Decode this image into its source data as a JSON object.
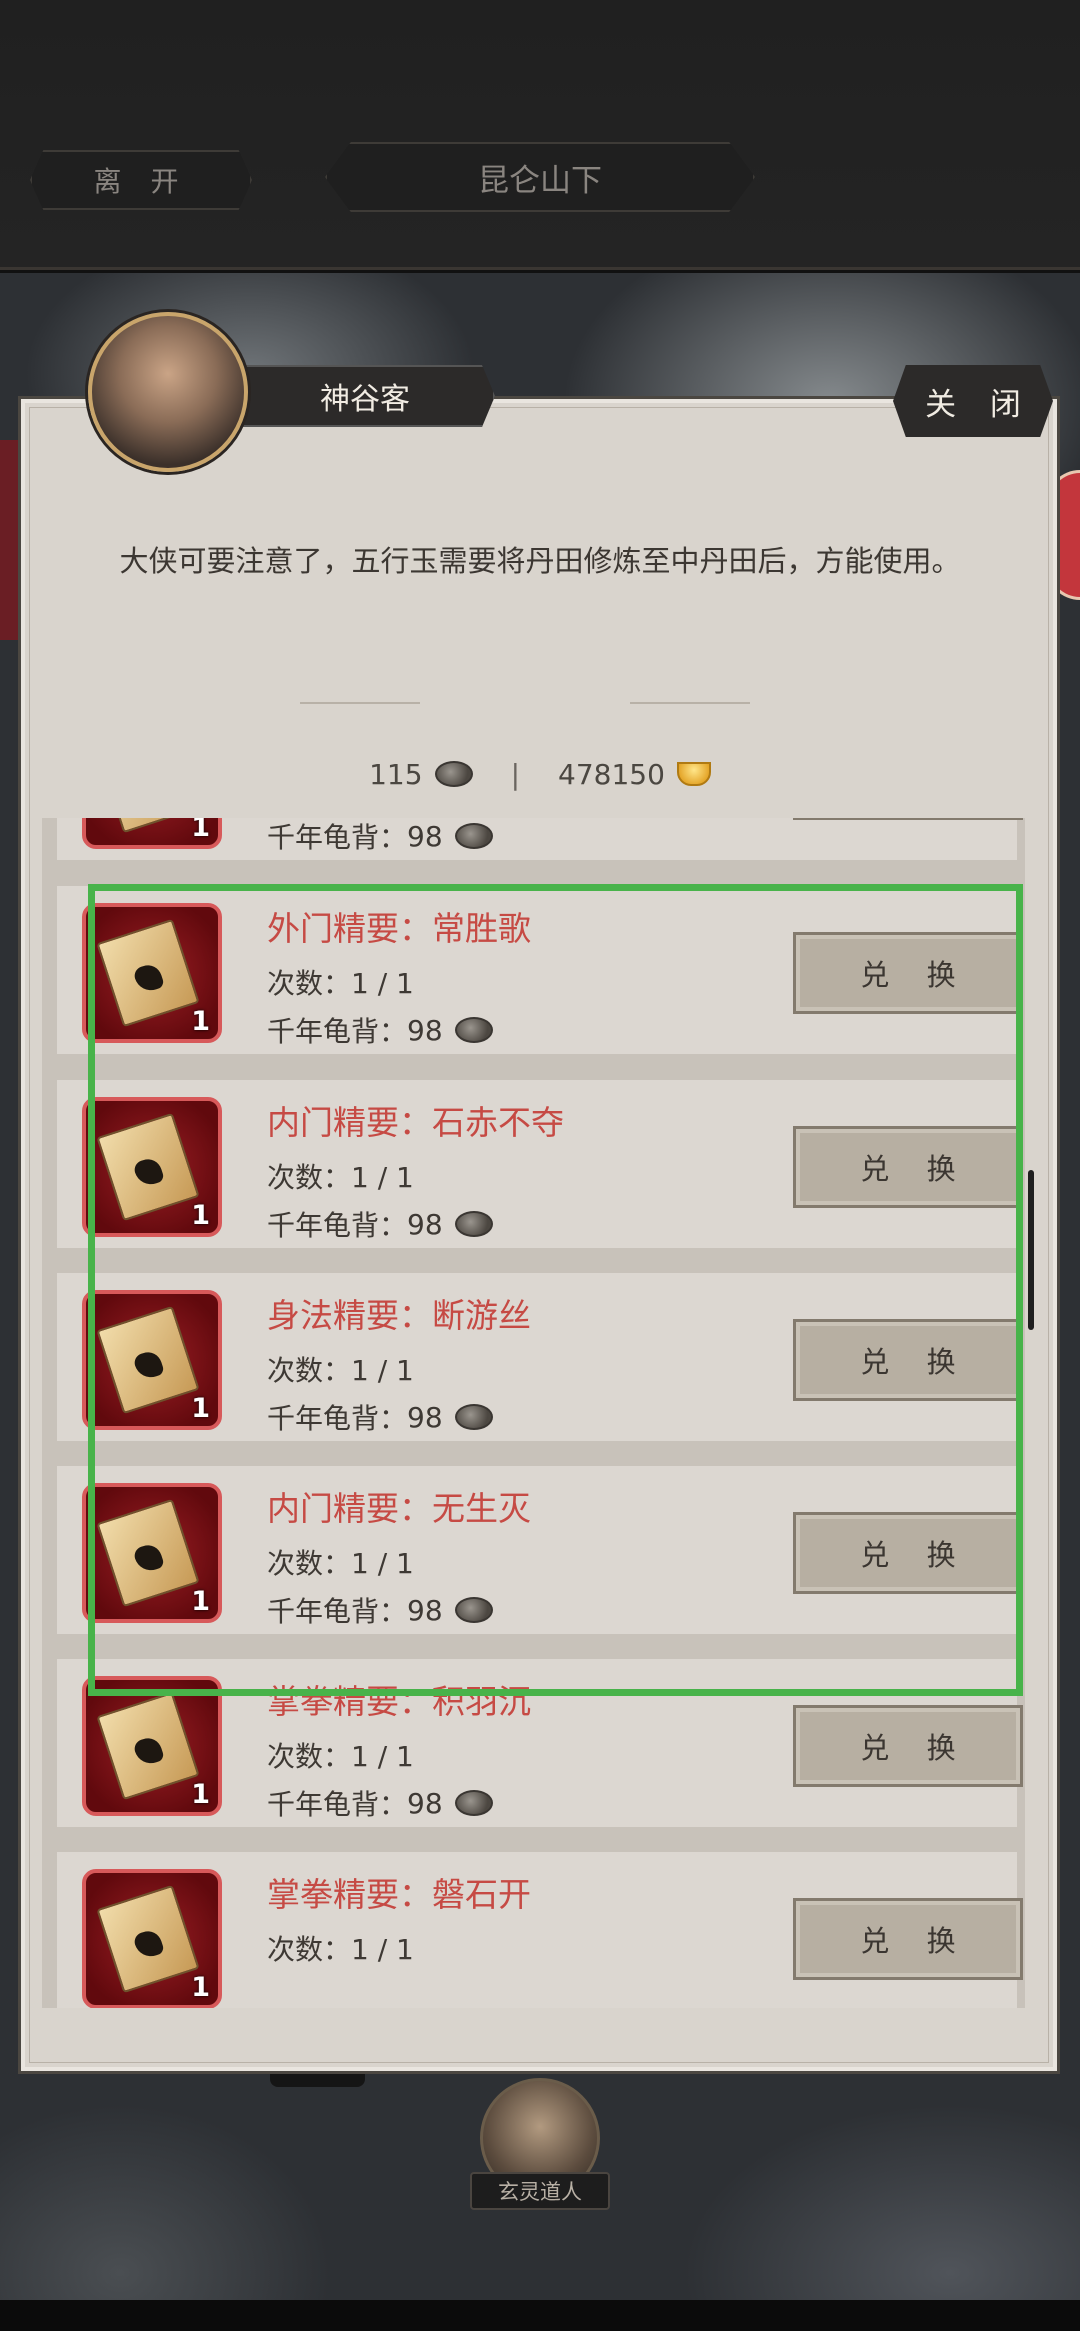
{
  "topbar": {
    "leave_label": "离 开",
    "location": "昆仑山下"
  },
  "scene": {
    "npc_label": "玄灵道人"
  },
  "dialog": {
    "speaker": "神谷客",
    "close_label": "关 闭",
    "message": "大侠可要注意了，五行玉需要将丹田修炼至中丹田后，方能使用。"
  },
  "currency": {
    "tortoise_amount": "115",
    "separator": "|",
    "gold_amount": "478150"
  },
  "items": [
    {
      "title": "",
      "count": "",
      "cost_label": "千年龟背：",
      "cost": "98",
      "qty": "1",
      "button": ""
    },
    {
      "title": "外门精要：常胜歌",
      "count": "次数：1 / 1",
      "cost_label": "千年龟背：",
      "cost": "98",
      "qty": "1",
      "button": "兑 换"
    },
    {
      "title": "内门精要：石赤不夺",
      "count": "次数：1 / 1",
      "cost_label": "千年龟背：",
      "cost": "98",
      "qty": "1",
      "button": "兑 换"
    },
    {
      "title": "身法精要：断游丝",
      "count": "次数：1 / 1",
      "cost_label": "千年龟背：",
      "cost": "98",
      "qty": "1",
      "button": "兑 换"
    },
    {
      "title": "内门精要：无生灭",
      "count": "次数：1 / 1",
      "cost_label": "千年龟背：",
      "cost": "98",
      "qty": "1",
      "button": "兑 换"
    },
    {
      "title": "掌拳精要：积羽沉",
      "count": "次数：1 / 1",
      "cost_label": "千年龟背：",
      "cost": "98",
      "qty": "1",
      "button": "兑 换"
    },
    {
      "title": "掌拳精要：磐石开",
      "count": "次数：1 / 1",
      "cost_label": "",
      "cost": "",
      "qty": "1",
      "button": "兑 换"
    }
  ],
  "colors": {
    "highlight": "#48b34a",
    "item_title": "#c64a44",
    "panel_bg": "#d9d4cd"
  }
}
